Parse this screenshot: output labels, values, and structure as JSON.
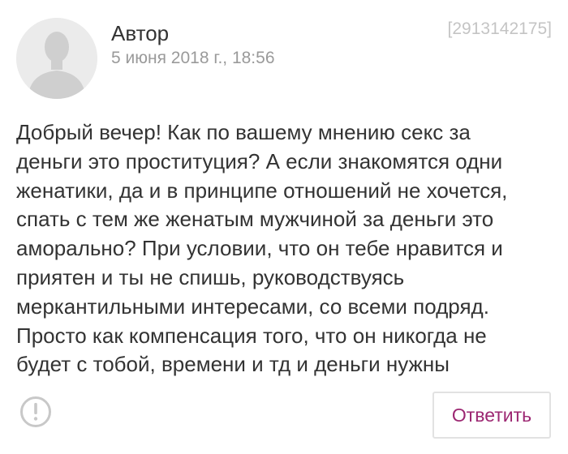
{
  "post": {
    "author": "Автор",
    "date": "5 июня 2018 г., 18:56",
    "id": "[2913142175]",
    "avatar_icon": "user-silhouette-icon",
    "body_lines": [
      "Добрый вечер! Как по вашему мнению секс за",
      "деньги это проституция? А если знакомятся одни",
      "женатики, да и в принципе отношений не хочется,",
      "спать с тем же женатым мужчиной за деньги это",
      "аморально? При условии, что он тебе нравится и",
      "приятен и ты не спишь, руководствуясь",
      "меркантильными интересами, со всеми подряд.",
      "Просто как компенсация того, что он никогда не",
      "будет с тобой, времени и тд и деньги нужны"
    ]
  },
  "actions": {
    "report_icon": "exclamation-circle-icon",
    "reply_label": "Ответить"
  },
  "colors": {
    "accent": "#9c2772",
    "text": "#333333",
    "muted": "#9a9a9a",
    "id_text": "#c4c4c4",
    "avatar_bg": "#ebebeb",
    "avatar_figure": "#cfcfcf"
  }
}
